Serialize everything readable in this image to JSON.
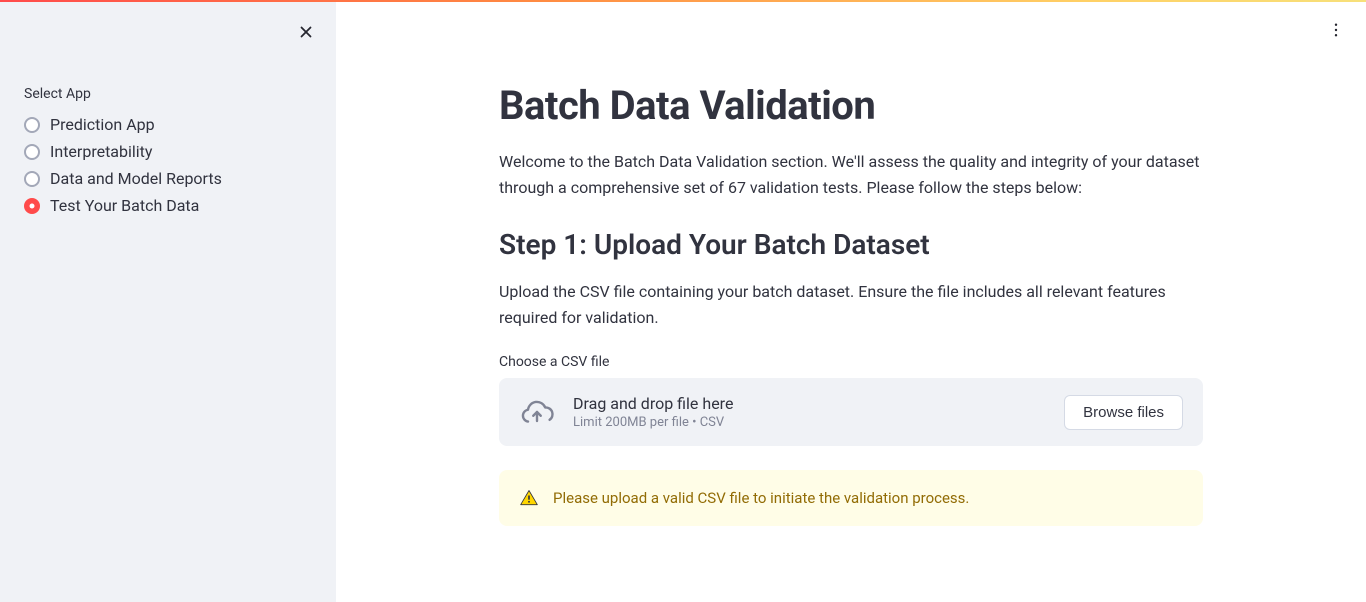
{
  "sidebar": {
    "label": "Select App",
    "options": [
      {
        "label": "Prediction App"
      },
      {
        "label": "Interpretability"
      },
      {
        "label": "Data and Model Reports"
      },
      {
        "label": "Test Your Batch Data"
      }
    ],
    "selected_index": 3
  },
  "main": {
    "title": "Batch Data Validation",
    "intro": "Welcome to the Batch Data Validation section. We'll assess the quality and integrity of your dataset through a comprehensive set of 67 validation tests. Please follow the steps below:",
    "step1_title": "Step 1: Upload Your Batch Dataset",
    "step1_desc": "Upload the CSV file containing your batch dataset. Ensure the file includes all relevant features required for validation.",
    "uploader": {
      "label": "Choose a CSV file",
      "main_text": "Drag and drop file here",
      "sub_text": "Limit 200MB per file • CSV",
      "browse_label": "Browse files"
    },
    "warning": "Please upload a valid CSV file to initiate the validation process."
  }
}
